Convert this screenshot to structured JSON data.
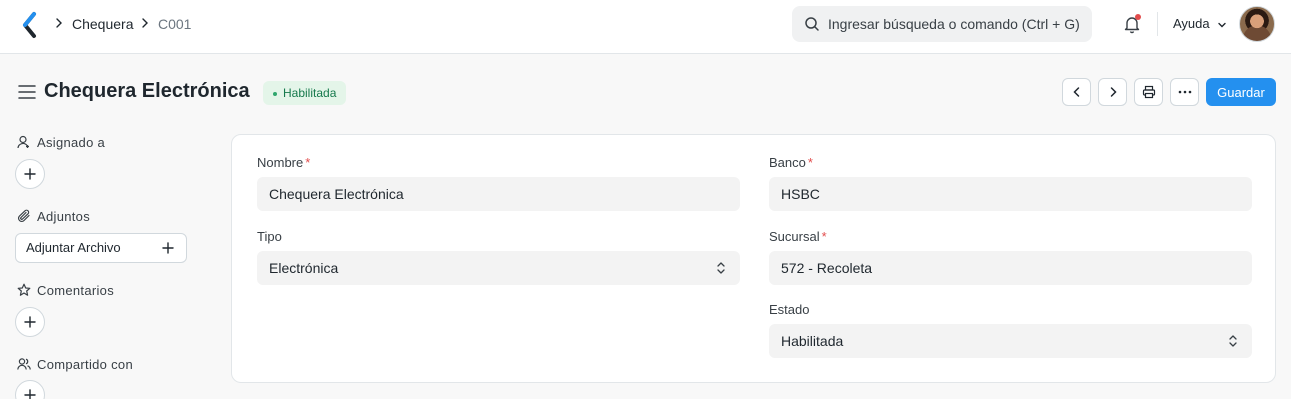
{
  "navbar": {
    "breadcrumbs": [
      "Chequera",
      "C001"
    ],
    "search_placeholder": "Ingresar búsqueda o comando (Ctrl + G)",
    "help_label": "Ayuda"
  },
  "page": {
    "title": "Chequera Electrónica",
    "status": "Habilitada",
    "save_label": "Guardar",
    "colors": {
      "primary": "#2490ef",
      "status_bg": "#e4f5e9",
      "status_text": "#16794c",
      "required": "#e24c4c"
    }
  },
  "sidebar": {
    "assigned_label": "Asignado a",
    "attachments_label": "Adjuntos",
    "attach_button": "Adjuntar Archivo",
    "comments_label": "Comentarios",
    "shared_label": "Compartido con"
  },
  "form": {
    "nombre": {
      "label": "Nombre",
      "required": "*",
      "value": "Chequera Electrónica"
    },
    "tipo": {
      "label": "Tipo",
      "value": "Electrónica"
    },
    "banco": {
      "label": "Banco",
      "required": "*",
      "value": "HSBC"
    },
    "sucursal": {
      "label": "Sucursal",
      "required": "*",
      "value": "572 - Recoleta"
    },
    "estado": {
      "label": "Estado",
      "value": "Habilitada"
    }
  }
}
